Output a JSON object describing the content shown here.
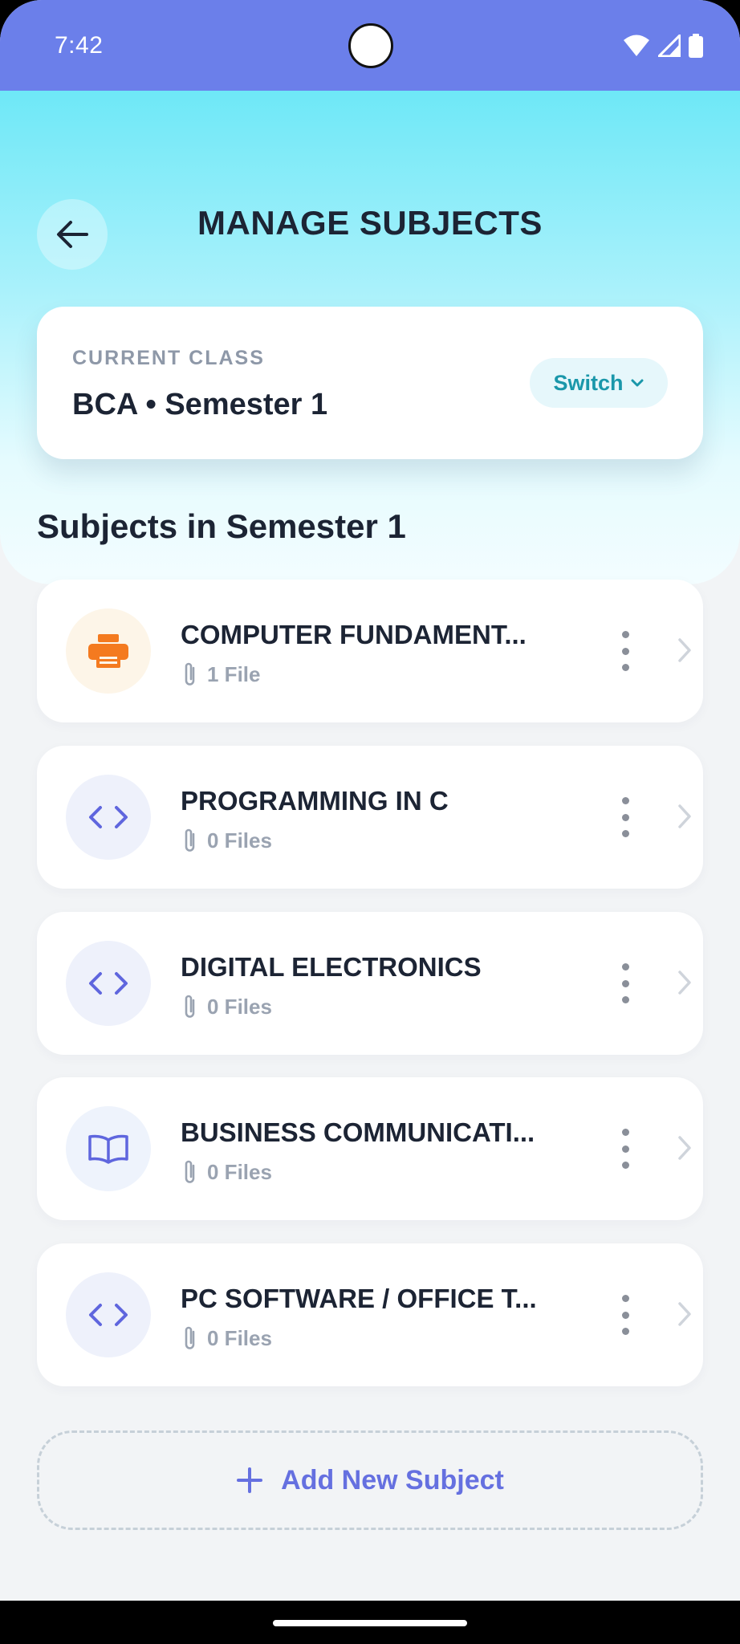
{
  "status_bar": {
    "time": "7:42"
  },
  "header": {
    "title": "MANAGE SUBJECTS"
  },
  "current_class": {
    "label": "CURRENT CLASS",
    "name": "BCA • Semester 1",
    "switch_label": "Switch"
  },
  "section_title": "Subjects in Semester 1",
  "subjects": [
    {
      "name": "COMPUTER FUNDAMENT...",
      "files": "1 File",
      "icon": "printer-icon",
      "icon_bg": "#fdf5e8",
      "icon_color": "#f47a1f"
    },
    {
      "name": "PROGRAMMING IN C",
      "files": "0 Files",
      "icon": "code-icon",
      "icon_bg": "#eef1fb",
      "icon_color": "#5f66de"
    },
    {
      "name": "DIGITAL ELECTRONICS",
      "files": "0 Files",
      "icon": "code-icon",
      "icon_bg": "#eef1fb",
      "icon_color": "#5f66de"
    },
    {
      "name": "BUSINESS COMMUNICATI...",
      "files": "0 Files",
      "icon": "book-icon",
      "icon_bg": "#eef3fc",
      "icon_color": "#5f66de"
    },
    {
      "name": "PC SOFTWARE / OFFICE T...",
      "files": "0 Files",
      "icon": "code-icon",
      "icon_bg": "#eef1fb",
      "icon_color": "#5f66de"
    }
  ],
  "add_button_label": "Add New Subject",
  "colors": {
    "status_bar": "#6b7fea",
    "accent": "#6570e0",
    "switch_text": "#1a97aa",
    "title": "#1c2434",
    "muted": "#9aa3b1"
  }
}
